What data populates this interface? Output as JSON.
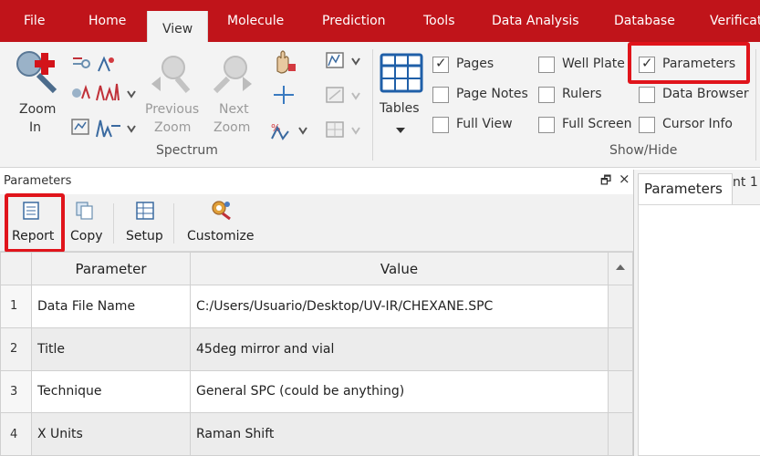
{
  "menu": {
    "items": [
      "File",
      "Home",
      "View",
      "Molecule",
      "Prediction",
      "Tools",
      "Data Analysis",
      "Database",
      "Verificat"
    ],
    "active": "View"
  },
  "ribbon": {
    "zoom_in": [
      "Zoom",
      "In"
    ],
    "previous_zoom": [
      "Previous",
      "Zoom"
    ],
    "next_zoom": [
      "Next",
      "Zoom"
    ],
    "spectrum_group": "Spectrum",
    "tables": "Tables",
    "show_hide_group": "Show/Hide",
    "checkboxes": [
      {
        "label": "Pages",
        "checked": true
      },
      {
        "label": "Page Notes",
        "checked": false
      },
      {
        "label": "Full View",
        "checked": false
      },
      {
        "label": "Well Plate",
        "checked": false
      },
      {
        "label": "Rulers",
        "checked": false
      },
      {
        "label": "Full Screen",
        "checked": false
      },
      {
        "label": "Parameters",
        "checked": true
      },
      {
        "label": "Data Browser",
        "checked": false
      },
      {
        "label": "Cursor Info",
        "checked": false
      }
    ]
  },
  "panel": {
    "title": "Parameters",
    "float_glyph": "🗗",
    "close_glyph": "×",
    "toolbar": [
      "Report",
      "Copy",
      "Setup",
      "Customize"
    ]
  },
  "table": {
    "columns": [
      "Parameter",
      "Value"
    ],
    "rows": [
      {
        "num": "1",
        "parameter": "Data File Name",
        "value": "C:/Users/Usuario/Desktop/UV-IR/CHEXANE.SPC"
      },
      {
        "num": "2",
        "parameter": "Title",
        "value": "45deg mirror and vial"
      },
      {
        "num": "3",
        "parameter": "Technique",
        "value": "General SPC (could be anything)"
      },
      {
        "num": "4",
        "parameter": "X Units",
        "value": "Raman Shift"
      }
    ]
  },
  "right_pane": {
    "tab": "Parameters",
    "tab2": "nt 1"
  },
  "colors": {
    "brand_red": "#c0141a",
    "highlight_red": "#e0141b"
  }
}
